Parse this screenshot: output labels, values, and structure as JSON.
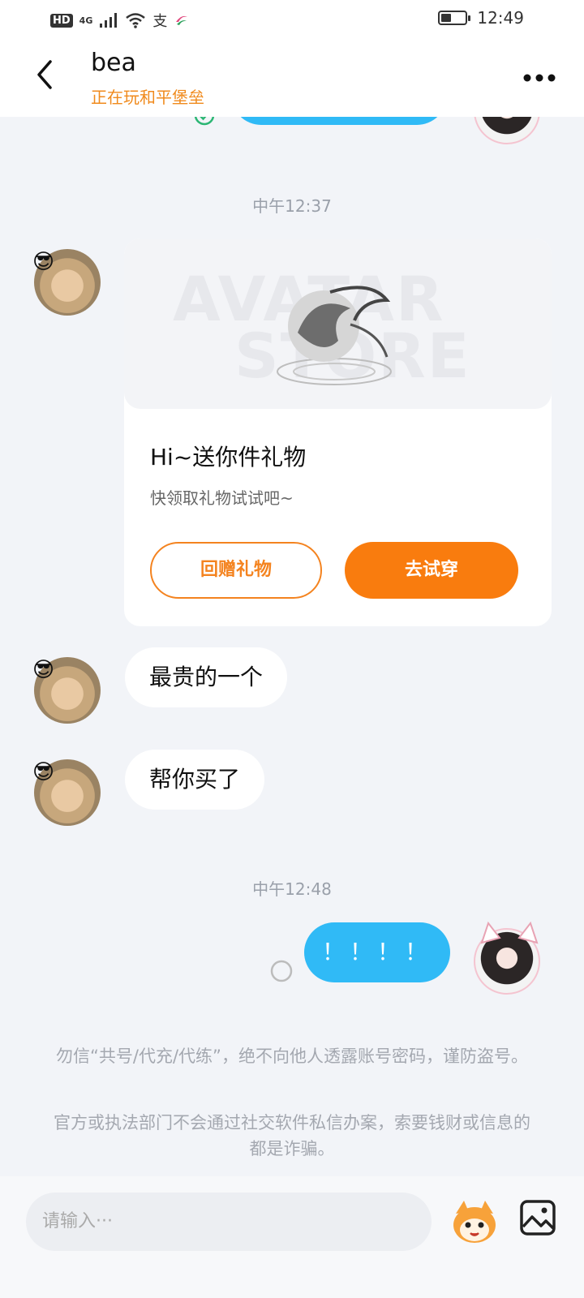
{
  "status_bar": {
    "hd": "HD",
    "network": "4G",
    "time": "12:49",
    "battery_percent": 40,
    "icons": [
      "signal-icon",
      "wifi-icon",
      "alipay-icon",
      "china-mobile-icon",
      "battery-icon"
    ]
  },
  "header": {
    "name": "bea",
    "status": "正在玩和平堡垒"
  },
  "chat": {
    "divider_1": "中午12:37",
    "gift_card": {
      "watermark_top": "AVATAR",
      "watermark_bottom": "STORE",
      "title": "Hi~送你件礼物",
      "subtitle": "快领取礼物试试吧~",
      "return_gift_label": "回赠礼物",
      "try_on_label": "去试穿"
    },
    "msg_1": "最贵的一个",
    "msg_2": "帮你买了",
    "divider_2": "中午12:48",
    "msg_3": "！！！！",
    "warning_1": "勿信“共号/代充/代练”，绝不向他人透露账号密码，谨防盗号。",
    "warning_2": "官方或执法部门不会通过社交软件私信办案，索要钱财或信息的都是诈骗。"
  },
  "input_bar": {
    "placeholder": "请输入···"
  },
  "colors": {
    "accent_orange": "#f97c0e",
    "bubble_blue": "#30baf6",
    "status_orange": "#f08a1c"
  }
}
